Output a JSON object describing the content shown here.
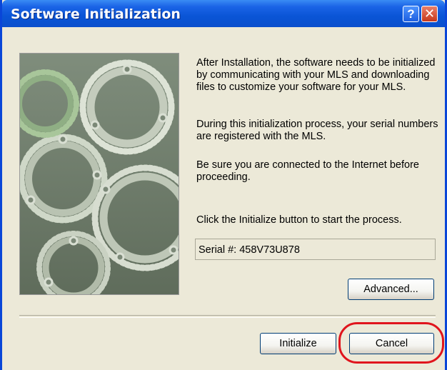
{
  "window": {
    "title": "Software Initialization",
    "help_glyph": "?",
    "close_glyph": "✕"
  },
  "description": {
    "p1": "After Installation, the software needs to be initialized by communicating with your MLS and downloading files to customize your software for your MLS.",
    "p2": "During this initialization process, your serial numbers are registered with the MLS.",
    "p3": "Be sure you are connected to the Internet before proceeding.",
    "p4": "Click the Initialize button to start the process."
  },
  "serial": {
    "text": "Serial #: 458V73U878"
  },
  "buttons": {
    "advanced": "Advanced...",
    "initialize": "Initialize",
    "cancel": "Cancel"
  },
  "colors": {
    "titlebar": "#0a55d6",
    "dialog_bg": "#ece9d8",
    "highlight": "#e0151d"
  },
  "icons": [
    "help-icon",
    "close-icon",
    "gears-illustration"
  ]
}
